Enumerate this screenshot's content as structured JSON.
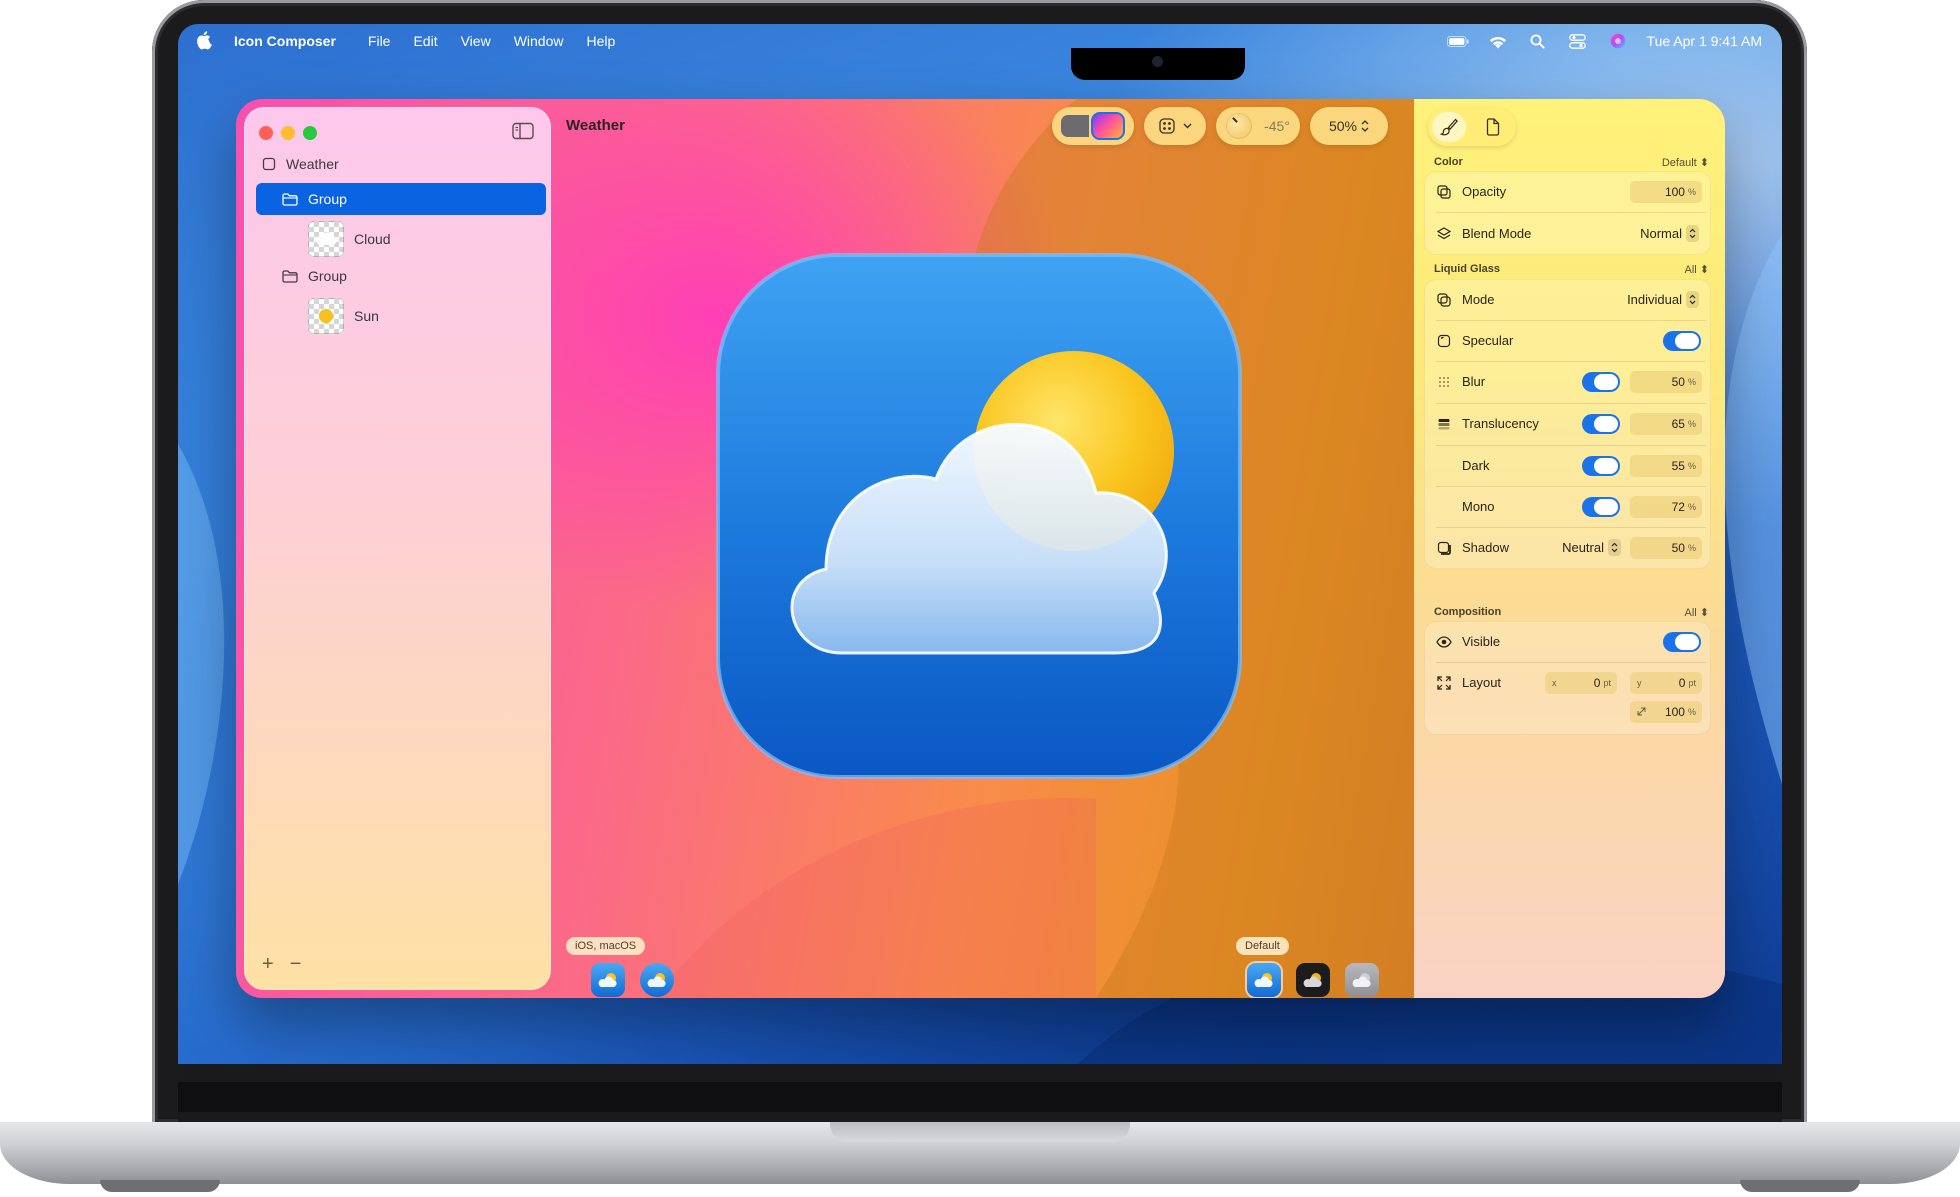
{
  "menubar": {
    "app_name": "Icon Composer",
    "items": [
      "File",
      "Edit",
      "View",
      "Window",
      "Help"
    ],
    "clock": "Tue Apr 1  9:41 AM"
  },
  "sidebar": {
    "root_label": "Weather",
    "items": [
      {
        "label": "Group",
        "selected": true
      },
      {
        "label": "Cloud"
      },
      {
        "label": "Group"
      },
      {
        "label": "Sun"
      }
    ],
    "add_label": "+",
    "remove_label": "−"
  },
  "canvas": {
    "document_title": "Weather",
    "angle_value": "-45°",
    "zoom_value": "50%",
    "platform_badge": "iOS, macOS",
    "appearance_badge": "Default"
  },
  "inspector": {
    "color": {
      "title": "Color",
      "option": "Default",
      "opacity_label": "Opacity",
      "opacity_value": "100",
      "blend_label": "Blend Mode",
      "blend_value": "Normal"
    },
    "liquid_glass": {
      "title": "Liquid Glass",
      "option": "All",
      "mode_label": "Mode",
      "mode_value": "Individual",
      "specular_label": "Specular",
      "blur_label": "Blur",
      "blur_value": "50",
      "translucency_label": "Translucency",
      "translucency_value": "65",
      "dark_label": "Dark",
      "dark_value": "55",
      "mono_label": "Mono",
      "mono_value": "72",
      "shadow_label": "Shadow",
      "shadow_mode": "Neutral",
      "shadow_value": "50"
    },
    "composition": {
      "title": "Composition",
      "option": "All",
      "visible_label": "Visible",
      "layout_label": "Layout",
      "x_label": "x",
      "x_value": "0",
      "y_label": "y",
      "y_value": "0",
      "scale_value": "100"
    },
    "units": {
      "percent": "%",
      "points": "pt"
    }
  },
  "colors": {
    "accent": "#0a63e0",
    "toggle_on": "#1a73e8"
  }
}
